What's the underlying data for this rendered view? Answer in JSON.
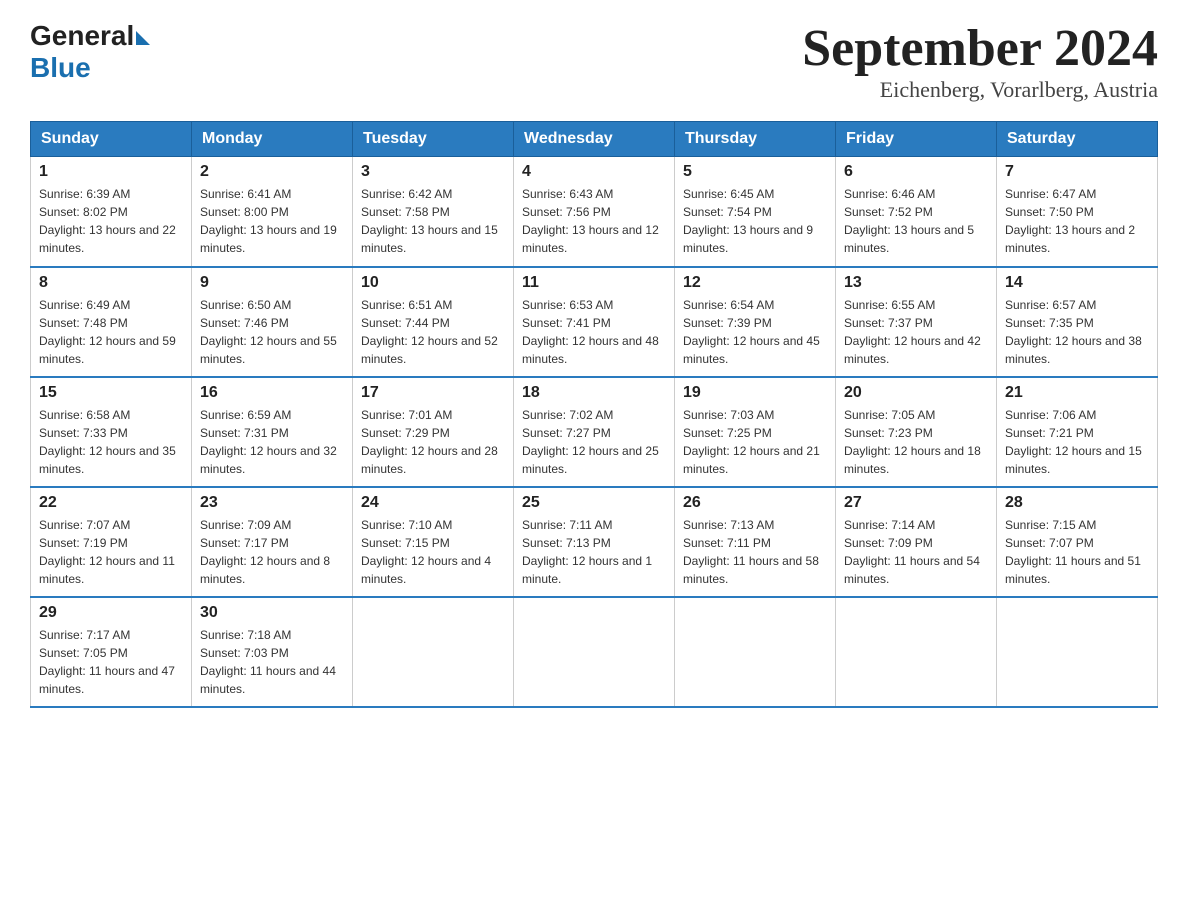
{
  "header": {
    "logo": {
      "general": "General",
      "blue": "Blue"
    },
    "title": "September 2024",
    "subtitle": "Eichenberg, Vorarlberg, Austria"
  },
  "days_of_week": [
    "Sunday",
    "Monday",
    "Tuesday",
    "Wednesday",
    "Thursday",
    "Friday",
    "Saturday"
  ],
  "weeks": [
    [
      {
        "day": "1",
        "sunrise": "6:39 AM",
        "sunset": "8:02 PM",
        "daylight": "13 hours and 22 minutes."
      },
      {
        "day": "2",
        "sunrise": "6:41 AM",
        "sunset": "8:00 PM",
        "daylight": "13 hours and 19 minutes."
      },
      {
        "day": "3",
        "sunrise": "6:42 AM",
        "sunset": "7:58 PM",
        "daylight": "13 hours and 15 minutes."
      },
      {
        "day": "4",
        "sunrise": "6:43 AM",
        "sunset": "7:56 PM",
        "daylight": "13 hours and 12 minutes."
      },
      {
        "day": "5",
        "sunrise": "6:45 AM",
        "sunset": "7:54 PM",
        "daylight": "13 hours and 9 minutes."
      },
      {
        "day": "6",
        "sunrise": "6:46 AM",
        "sunset": "7:52 PM",
        "daylight": "13 hours and 5 minutes."
      },
      {
        "day": "7",
        "sunrise": "6:47 AM",
        "sunset": "7:50 PM",
        "daylight": "13 hours and 2 minutes."
      }
    ],
    [
      {
        "day": "8",
        "sunrise": "6:49 AM",
        "sunset": "7:48 PM",
        "daylight": "12 hours and 59 minutes."
      },
      {
        "day": "9",
        "sunrise": "6:50 AM",
        "sunset": "7:46 PM",
        "daylight": "12 hours and 55 minutes."
      },
      {
        "day": "10",
        "sunrise": "6:51 AM",
        "sunset": "7:44 PM",
        "daylight": "12 hours and 52 minutes."
      },
      {
        "day": "11",
        "sunrise": "6:53 AM",
        "sunset": "7:41 PM",
        "daylight": "12 hours and 48 minutes."
      },
      {
        "day": "12",
        "sunrise": "6:54 AM",
        "sunset": "7:39 PM",
        "daylight": "12 hours and 45 minutes."
      },
      {
        "day": "13",
        "sunrise": "6:55 AM",
        "sunset": "7:37 PM",
        "daylight": "12 hours and 42 minutes."
      },
      {
        "day": "14",
        "sunrise": "6:57 AM",
        "sunset": "7:35 PM",
        "daylight": "12 hours and 38 minutes."
      }
    ],
    [
      {
        "day": "15",
        "sunrise": "6:58 AM",
        "sunset": "7:33 PM",
        "daylight": "12 hours and 35 minutes."
      },
      {
        "day": "16",
        "sunrise": "6:59 AM",
        "sunset": "7:31 PM",
        "daylight": "12 hours and 32 minutes."
      },
      {
        "day": "17",
        "sunrise": "7:01 AM",
        "sunset": "7:29 PM",
        "daylight": "12 hours and 28 minutes."
      },
      {
        "day": "18",
        "sunrise": "7:02 AM",
        "sunset": "7:27 PM",
        "daylight": "12 hours and 25 minutes."
      },
      {
        "day": "19",
        "sunrise": "7:03 AM",
        "sunset": "7:25 PM",
        "daylight": "12 hours and 21 minutes."
      },
      {
        "day": "20",
        "sunrise": "7:05 AM",
        "sunset": "7:23 PM",
        "daylight": "12 hours and 18 minutes."
      },
      {
        "day": "21",
        "sunrise": "7:06 AM",
        "sunset": "7:21 PM",
        "daylight": "12 hours and 15 minutes."
      }
    ],
    [
      {
        "day": "22",
        "sunrise": "7:07 AM",
        "sunset": "7:19 PM",
        "daylight": "12 hours and 11 minutes."
      },
      {
        "day": "23",
        "sunrise": "7:09 AM",
        "sunset": "7:17 PM",
        "daylight": "12 hours and 8 minutes."
      },
      {
        "day": "24",
        "sunrise": "7:10 AM",
        "sunset": "7:15 PM",
        "daylight": "12 hours and 4 minutes."
      },
      {
        "day": "25",
        "sunrise": "7:11 AM",
        "sunset": "7:13 PM",
        "daylight": "12 hours and 1 minute."
      },
      {
        "day": "26",
        "sunrise": "7:13 AM",
        "sunset": "7:11 PM",
        "daylight": "11 hours and 58 minutes."
      },
      {
        "day": "27",
        "sunrise": "7:14 AM",
        "sunset": "7:09 PM",
        "daylight": "11 hours and 54 minutes."
      },
      {
        "day": "28",
        "sunrise": "7:15 AM",
        "sunset": "7:07 PM",
        "daylight": "11 hours and 51 minutes."
      }
    ],
    [
      {
        "day": "29",
        "sunrise": "7:17 AM",
        "sunset": "7:05 PM",
        "daylight": "11 hours and 47 minutes."
      },
      {
        "day": "30",
        "sunrise": "7:18 AM",
        "sunset": "7:03 PM",
        "daylight": "11 hours and 44 minutes."
      },
      null,
      null,
      null,
      null,
      null
    ]
  ],
  "labels": {
    "sunrise": "Sunrise:",
    "sunset": "Sunset:",
    "daylight": "Daylight:"
  }
}
